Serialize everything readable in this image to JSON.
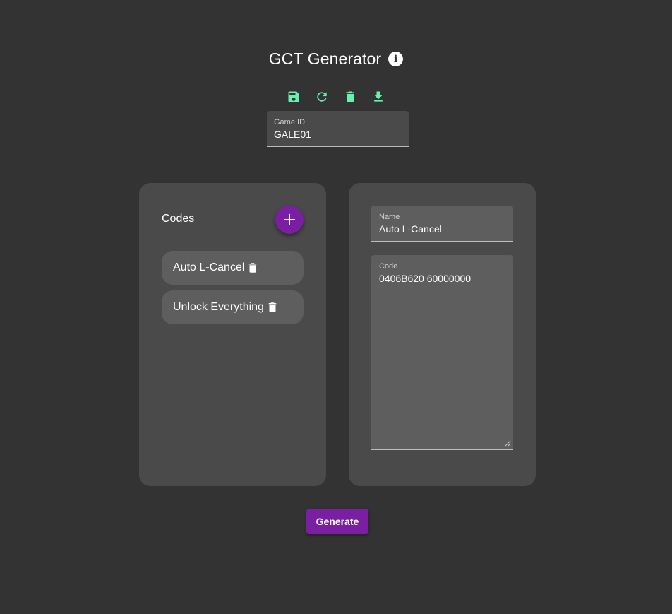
{
  "header": {
    "title": "GCT Generator",
    "info_icon": "info-icon"
  },
  "toolbar": {
    "icons": [
      "save-icon",
      "refresh-icon",
      "delete-icon",
      "download-icon"
    ],
    "icon_color": "#69f0ae"
  },
  "game_id": {
    "label": "Game ID",
    "value": "GALE01"
  },
  "codes_panel": {
    "title": "Codes",
    "add_icon": "plus-icon",
    "items": [
      {
        "label": "Auto L-Cancel"
      },
      {
        "label": "Unlock Everything"
      }
    ]
  },
  "editor": {
    "name_label": "Name",
    "name_value": "Auto L-Cancel",
    "code_label": "Code",
    "code_value": "0406B620 60000000"
  },
  "actions": {
    "generate_label": "Generate"
  },
  "colors": {
    "background": "#333333",
    "card": "#4a4a4a",
    "accent": "#7b1fa2",
    "toolbar_icon": "#69f0ae"
  }
}
